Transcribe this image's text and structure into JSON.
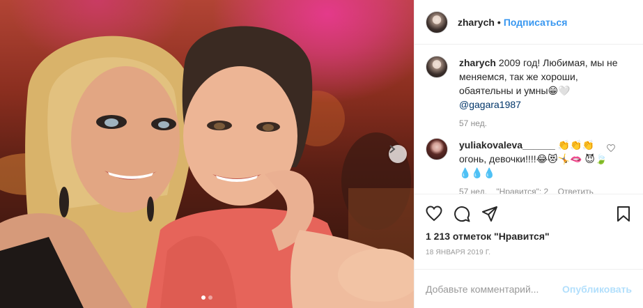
{
  "post": {
    "username": "zharych",
    "separator": "•",
    "follow_label": "Подписаться"
  },
  "caption": {
    "username": "zharych",
    "text": "2009 год! Любимая, мы не меняемся, так же хороши, обаятельны и умны😁🤍",
    "mention": "@gagara1987",
    "time": "57 нед."
  },
  "comment": {
    "username": "yuliakovaleva______",
    "text": "👏👏👏 огонь, девочки!!!!😂😻🤸🫦 😈🍃💧💧💧",
    "time": "57 нед.",
    "likes": "\"Нравится\": 2",
    "reply": "Ответить"
  },
  "photo": {
    "dots": [
      true,
      false
    ],
    "next_icon": "chevron-right-icon"
  },
  "stats": {
    "likes_label": "1 213 отметок \"Нравится\"",
    "date": "18 января 2019 г."
  },
  "composer": {
    "placeholder": "Добавьте комментарий...",
    "publish_label": "Опубликовать"
  },
  "colors": {
    "accent": "#3897f0",
    "publish_disabled": "#b2dffc",
    "secondary_text": "#8e8e8e"
  }
}
